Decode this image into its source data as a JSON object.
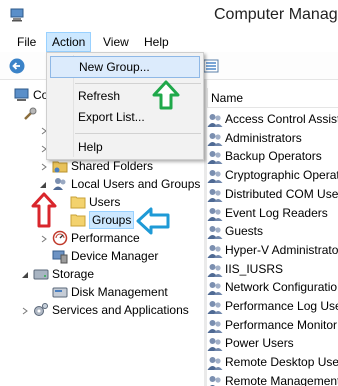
{
  "window": {
    "title": "Computer Manage"
  },
  "menubar": {
    "file": "File",
    "action": "Action",
    "view": "View",
    "help": "Help"
  },
  "action_menu": {
    "new_group": "New Group...",
    "refresh": "Refresh",
    "export_list": "Export List...",
    "help": "Help"
  },
  "tree": {
    "root_partial": "Co",
    "shared_folders": "Shared Folders",
    "local_users_groups": "Local Users and Groups",
    "users": "Users",
    "groups": "Groups",
    "performance": "Performance",
    "device_manager": "Device Manager",
    "storage": "Storage",
    "disk_management": "Disk Management",
    "services_applications": "Services and Applications"
  },
  "list": {
    "column_name": "Name",
    "items": [
      "Access Control Assist",
      "Administrators",
      "Backup Operators",
      "Cryptographic Operat",
      "Distributed COM Use",
      "Event Log Readers",
      "Guests",
      "Hyper-V Administrato",
      "IIS_IUSRS",
      "Network Configuratio",
      "Performance Log Use",
      "Performance Monitor",
      "Power Users",
      "Remote Desktop User",
      "Remote Management"
    ]
  },
  "colors": {
    "annotation_green": "#1fa84a",
    "annotation_red": "#d9262c",
    "annotation_blue": "#1e9ad6",
    "selection": "#cce8ff",
    "menu_highlight": "#dcebfc"
  }
}
